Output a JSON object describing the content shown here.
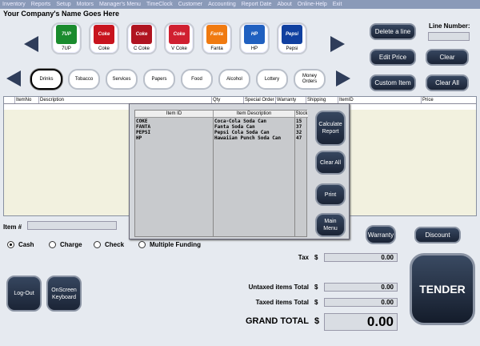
{
  "menu": [
    "Inventory",
    "Reports",
    "Setup",
    "Motors",
    "Manager's Menu",
    "TimeClock",
    "Customer",
    "Accounting",
    "Report Date",
    "About",
    "Online-Help",
    "Exit"
  ],
  "company_name": "Your Company's Name Goes Here",
  "products": [
    {
      "label": "7UP",
      "color": "#1a8b2e",
      "logo": "7UP"
    },
    {
      "label": "Coke",
      "color": "#c8141e",
      "logo": "Coke"
    },
    {
      "label": "C Coke",
      "color": "#b01420",
      "logo": "Coke"
    },
    {
      "label": "V Coke",
      "color": "#d02030",
      "logo": "Coke"
    },
    {
      "label": "Fanta",
      "color": "#f07a10",
      "logo": "Fanta"
    },
    {
      "label": "HP",
      "color": "#2060c0",
      "logo": "HP"
    },
    {
      "label": "Pepsi",
      "color": "#1040a0",
      "logo": "Pepsi"
    }
  ],
  "categories": [
    "Drinks",
    "Tobacco",
    "Services",
    "Papers",
    "Food",
    "Alcohol",
    "Lottery",
    "Money Orders"
  ],
  "actions": {
    "delete_line": "Delete a line",
    "edit_price": "Edit Price",
    "custom_item": "Custom Item",
    "clear": "Clear",
    "clear_all": "Clear All",
    "line_number": "Line Number:"
  },
  "grid_columns": [
    "ItemNo",
    "Description",
    "Qty",
    "Special Order",
    "Warranty",
    "Shipping",
    "ItemID",
    "Price"
  ],
  "popup": {
    "headers": [
      "Item ID",
      "Item Description",
      "Stock"
    ],
    "rows": [
      {
        "id": "COKE",
        "desc": "Coca-Cola Soda Can",
        "stock": "15"
      },
      {
        "id": "FANTA",
        "desc": "Fanta Soda Can",
        "stock": "37"
      },
      {
        "id": "PEPSI",
        "desc": "Pepsi Cola Soda Can",
        "stock": "32"
      },
      {
        "id": "HP",
        "desc": "Hawaiian Punch Soda Can",
        "stock": "47"
      }
    ],
    "buttons": {
      "calc": "Calculate Report",
      "clear_all": "Clear All",
      "print": "Print",
      "main_menu": "Main Menu"
    }
  },
  "item_label": "Item #",
  "payment": {
    "cash": "Cash",
    "charge": "Charge",
    "check": "Check",
    "multiple": "Multiple Funding"
  },
  "buttons": {
    "warranty": "Warranty",
    "discount": "Discount",
    "logout": "Log-Out",
    "keyboard": "OnScreen Keyboard",
    "tender": "TENDER"
  },
  "totals": {
    "tax_label": "Tax",
    "tax_value": "0.00",
    "untaxed_label": "Untaxed items Total",
    "untaxed_value": "0.00",
    "taxed_label": "Taxed items Total",
    "taxed_value": "0.00",
    "grand_label": "GRAND TOTAL",
    "grand_value": "0.00",
    "currency": "$"
  }
}
